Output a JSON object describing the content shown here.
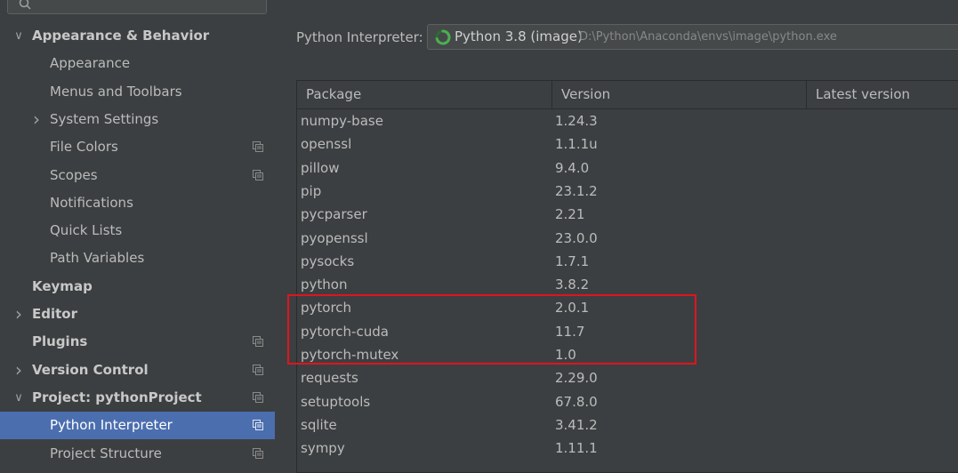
{
  "search": {
    "value": ""
  },
  "sidebar": {
    "items": [
      {
        "label": "Appearance & Behavior",
        "bold": true,
        "arrow": "expanded"
      },
      {
        "label": "Appearance"
      },
      {
        "label": "Menus and Toolbars"
      },
      {
        "label": "System Settings",
        "arrow": "collapsed"
      },
      {
        "label": "File Colors",
        "project_icon": true
      },
      {
        "label": "Scopes",
        "project_icon": true
      },
      {
        "label": "Notifications"
      },
      {
        "label": "Quick Lists"
      },
      {
        "label": "Path Variables"
      },
      {
        "label": "Keymap",
        "bold": true
      },
      {
        "label": "Editor",
        "bold": true,
        "arrow": "collapsed"
      },
      {
        "label": "Plugins",
        "bold": true,
        "project_icon": true
      },
      {
        "label": "Version Control",
        "bold": true,
        "arrow": "collapsed",
        "project_icon": true
      },
      {
        "label": "Project: pythonProject",
        "bold": true,
        "arrow": "expanded",
        "project_icon": true
      },
      {
        "label": "Python Interpreter",
        "selected": true,
        "project_icon": true
      },
      {
        "label": "Project Structure",
        "project_icon": true
      }
    ]
  },
  "main": {
    "interpreter_label": "Python Interpreter:",
    "interpreter_name": "Python 3.8 (image)",
    "interpreter_path": "D:\\Python\\Anaconda\\envs\\image\\python.exe"
  },
  "table": {
    "columns": [
      "Package",
      "Version",
      "Latest version"
    ],
    "rows": [
      {
        "package": "numpy-base",
        "version": "1.24.3",
        "latest": ""
      },
      {
        "package": "openssl",
        "version": "1.1.1u",
        "latest": ""
      },
      {
        "package": "pillow",
        "version": "9.4.0",
        "latest": ""
      },
      {
        "package": "pip",
        "version": "23.1.2",
        "latest": ""
      },
      {
        "package": "pycparser",
        "version": "2.21",
        "latest": ""
      },
      {
        "package": "pyopenssl",
        "version": "23.0.0",
        "latest": ""
      },
      {
        "package": "pysocks",
        "version": "1.7.1",
        "latest": ""
      },
      {
        "package": "python",
        "version": "3.8.2",
        "latest": ""
      },
      {
        "package": "pytorch",
        "version": "2.0.1",
        "latest": ""
      },
      {
        "package": "pytorch-cuda",
        "version": "11.7",
        "latest": ""
      },
      {
        "package": "pytorch-mutex",
        "version": "1.0",
        "latest": ""
      },
      {
        "package": "requests",
        "version": "2.29.0",
        "latest": ""
      },
      {
        "package": "setuptools",
        "version": "67.8.0",
        "latest": ""
      },
      {
        "package": "sqlite",
        "version": "3.41.2",
        "latest": ""
      },
      {
        "package": "sympy",
        "version": "1.11.1",
        "latest": ""
      }
    ]
  },
  "colors": {
    "background": "#3c3f41",
    "selection": "#4b6eaf",
    "annotation_box": "#e0141e",
    "spinner": "#4caf50"
  }
}
